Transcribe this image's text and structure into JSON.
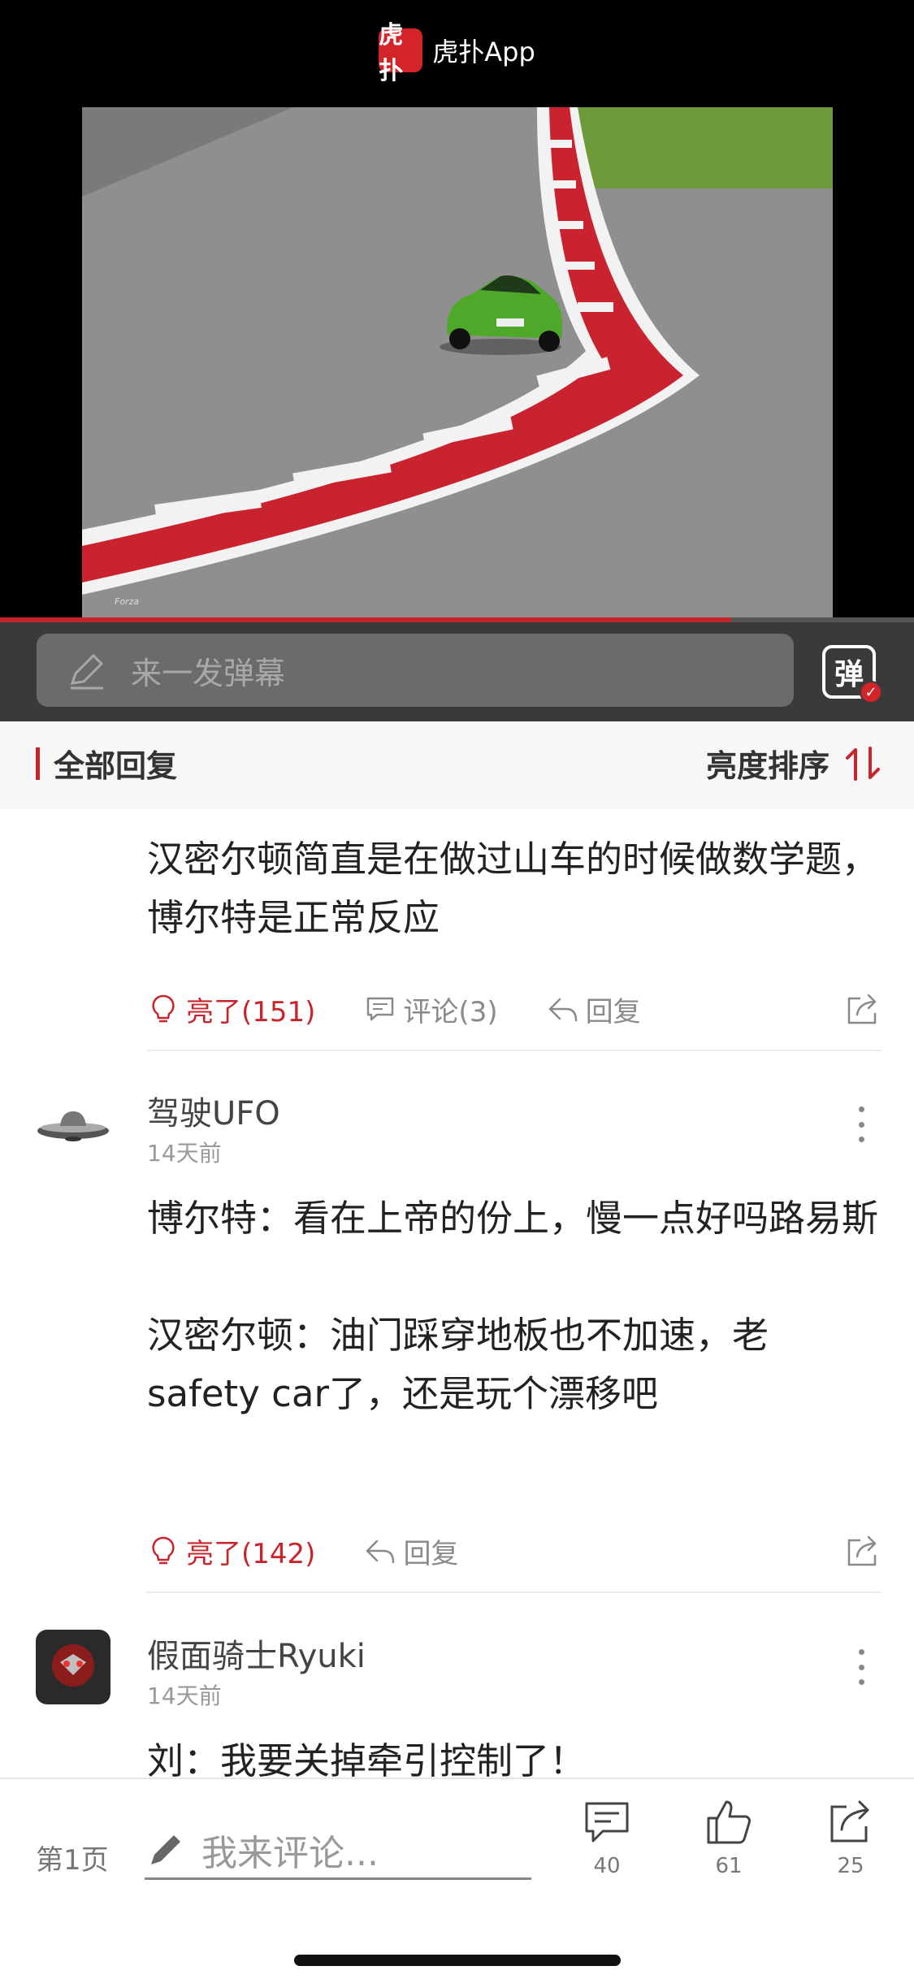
{
  "app_header": {
    "logo_text": "虎扑",
    "name": "虎扑App"
  },
  "video": {
    "progress_percent": 80,
    "watermark": "Forza"
  },
  "danmaku": {
    "placeholder": "来一发弹幕",
    "toggle_label": "弹"
  },
  "section": {
    "title": "全部回复",
    "sort_label": "亮度排序"
  },
  "comments": [
    {
      "text": "汉密尔顿简直是在做过山车的时候做数学题，博尔特是正常反应",
      "light_label": "亮了(151)",
      "comment_label": "评论(3)",
      "reply_label": "回复"
    },
    {
      "username": "驾驶UFO",
      "time": "14天前",
      "text": "博尔特：看在上帝的份上，慢一点好吗路易斯\n\n汉密尔顿：油门踩穿地板也不加速，老safety car了，还是玩个漂移吧",
      "light_label": "亮了(142)",
      "reply_label": "回复"
    },
    {
      "username": "假面骑士Ryuki",
      "time": "14天前",
      "text": "刘：我要关掉牵引控制了！"
    }
  ],
  "bottom_bar": {
    "page_label": "第1页",
    "compose_placeholder": "我来评论...",
    "comment_count": "40",
    "like_count": "61",
    "share_count": "25"
  },
  "colors": {
    "accent": "#c8242b",
    "video_bg": "#000000",
    "danmaku_bg": "#3a3a3a"
  }
}
